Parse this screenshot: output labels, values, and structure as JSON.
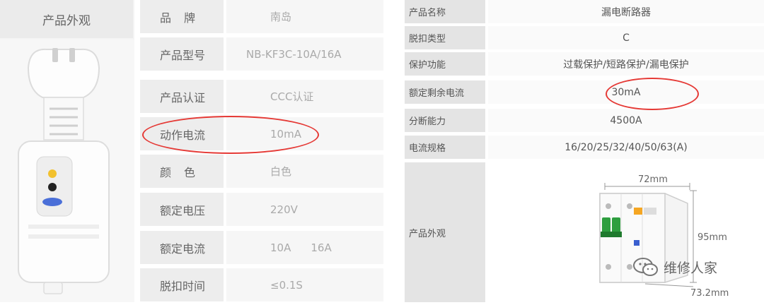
{
  "left": {
    "header": "产品外观"
  },
  "middle": {
    "rows": [
      {
        "label": "品牌",
        "value": "南岛"
      },
      {
        "label": "产品型号",
        "value": "NB-KF3C-10A/16A"
      },
      {
        "label": "产品认证",
        "value": "CCC认证"
      },
      {
        "label": "动作电流",
        "value": "10mA"
      },
      {
        "label": "颜色",
        "value": "白色"
      },
      {
        "label": "额定电压",
        "value": "220V"
      },
      {
        "label": "额定电流",
        "value": [
          "10A",
          "16A"
        ]
      },
      {
        "label": "脱扣时间",
        "value": "≤0.1S"
      }
    ]
  },
  "right": {
    "rows": [
      {
        "label": "产品名称",
        "value": "漏电断路器"
      },
      {
        "label": "脱扣类型",
        "value": "C"
      },
      {
        "label": "保护功能",
        "value": "过载保护/短路保护/漏电保护"
      },
      {
        "label": "额定剩余电流",
        "value": "30mA"
      },
      {
        "label": "分断能力",
        "value": "4500A"
      },
      {
        "label": "电流规格",
        "value": "16/20/25/32/40/50/63(A)"
      },
      {
        "label": "产品外观",
        "value": ""
      }
    ],
    "dimensions": {
      "width": "72mm",
      "height": "95mm",
      "depth": "73.2mm"
    }
  },
  "watermark": "维修人家",
  "colors": {
    "highlight": "#e53935",
    "breaker_green": "#2e9e3f",
    "breaker_orange": "#f5a623"
  }
}
